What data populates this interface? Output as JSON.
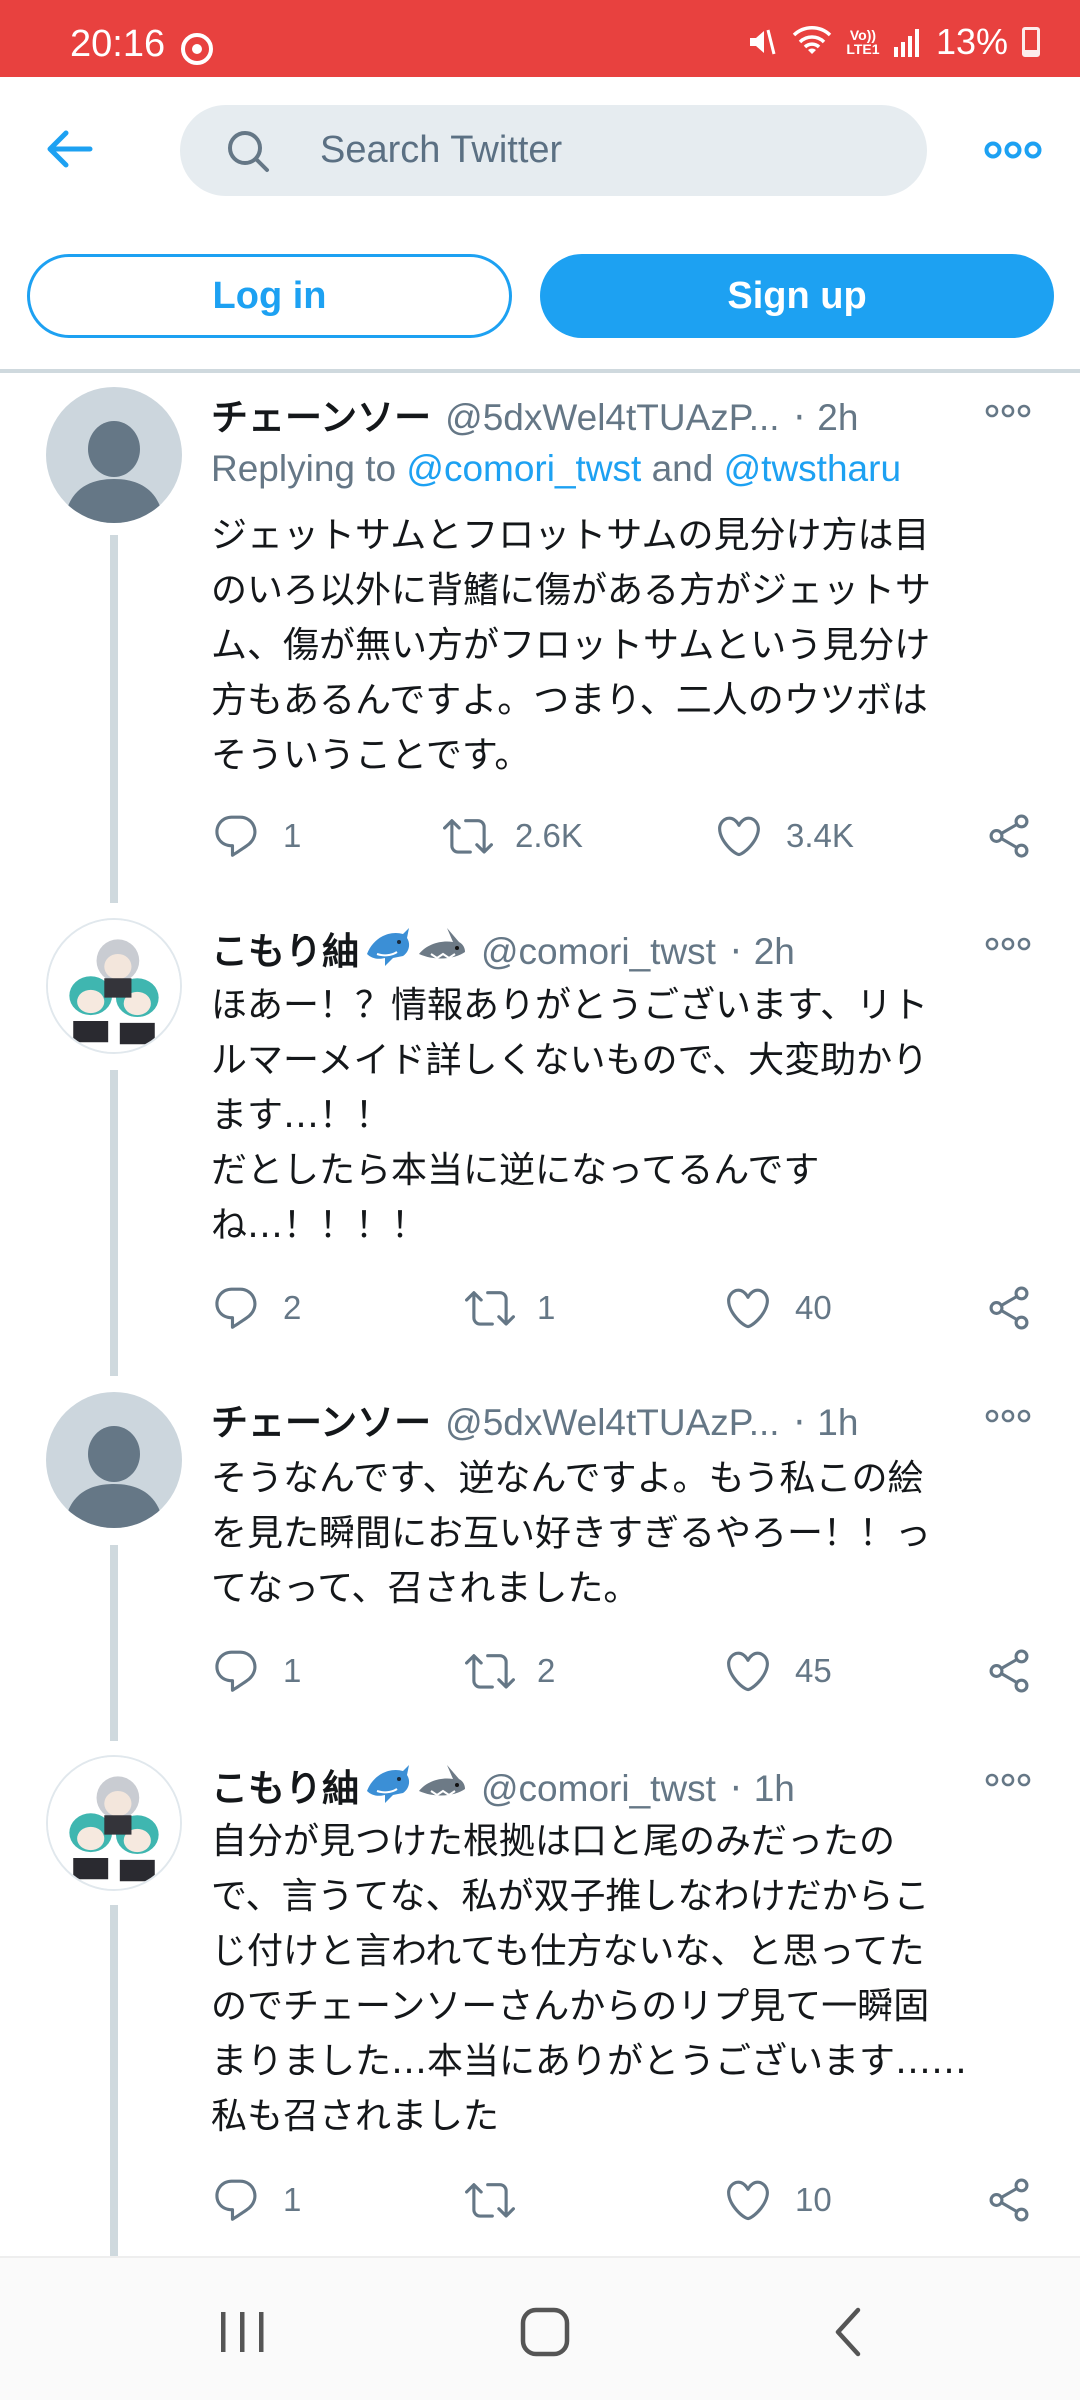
{
  "status_bar": {
    "time": "20:16",
    "volte_label": "Vo)) LTE1",
    "battery": "13%",
    "background": "#e8413f"
  },
  "search": {
    "placeholder": "Search Twitter"
  },
  "auth": {
    "login_label": "Log in",
    "signup_label": "Sign up",
    "accent": "#1da1f2"
  },
  "tweets": [
    {
      "name": "チェーンソー",
      "handle": "@5dxWel4tTUAzP...",
      "time": "2h",
      "replying_prefix": "Replying to ",
      "mention_1": "@comori_twst",
      "replying_and": " and ",
      "mention_2": "@twstharu",
      "text": "ジェットサムとフロットサムの見分け方は目\nのいろ以外に背鰭に傷がある方がジェットサ\nム、傷が無い方がフロットサムという見分け\n方もあるんですよ。つまり、二人のウツボは\nそういうことです。",
      "replies": "1",
      "retweets": "2.6K",
      "likes": "3.4K",
      "avatar": "default-avatar"
    },
    {
      "name": "こもり紬",
      "handle": "@comori_twst",
      "time": "2h",
      "text": "ほあー！？情報ありがとうございます、リト\nルマーメイド詳しくないもので、大変助かり\nます…！！\nだとしたら本当に逆になってるんです\nね…！！！！",
      "replies": "2",
      "retweets": "1",
      "likes": "40",
      "avatar": "anime-illustration-avatar"
    },
    {
      "name": "チェーンソー",
      "handle": "@5dxWel4tTUAzP...",
      "time": "1h",
      "text": "そうなんです、逆なんですよ。もう私この絵\nを見た瞬間にお互い好きすぎるやろー！！っ\nてなって、召されました。",
      "replies": "1",
      "retweets": "2",
      "likes": "45",
      "avatar": "default-avatar"
    },
    {
      "name": "こもり紬",
      "handle": "@comori_twst",
      "time": "1h",
      "text": "自分が見つけた根拠は口と尾のみだったの\nで、言うてな、私が双子推しなわけだからこ\nじ付けと言われても仕方ないな、と思ってた\nのでチェーンソーさんからのリプ見て一瞬固\nまりました…本当にありがとうございます……\n私も召されました",
      "replies": "1",
      "retweets": "",
      "likes": "10",
      "avatar": "anime-illustration-avatar"
    }
  ],
  "icons": [
    "back-arrow-icon",
    "search-icon",
    "more-icon",
    "reply-icon",
    "retweet-icon",
    "like-icon",
    "share-icon",
    "dolphin-emoji",
    "shark-emoji",
    "recents-icon",
    "home-icon",
    "back-icon"
  ]
}
